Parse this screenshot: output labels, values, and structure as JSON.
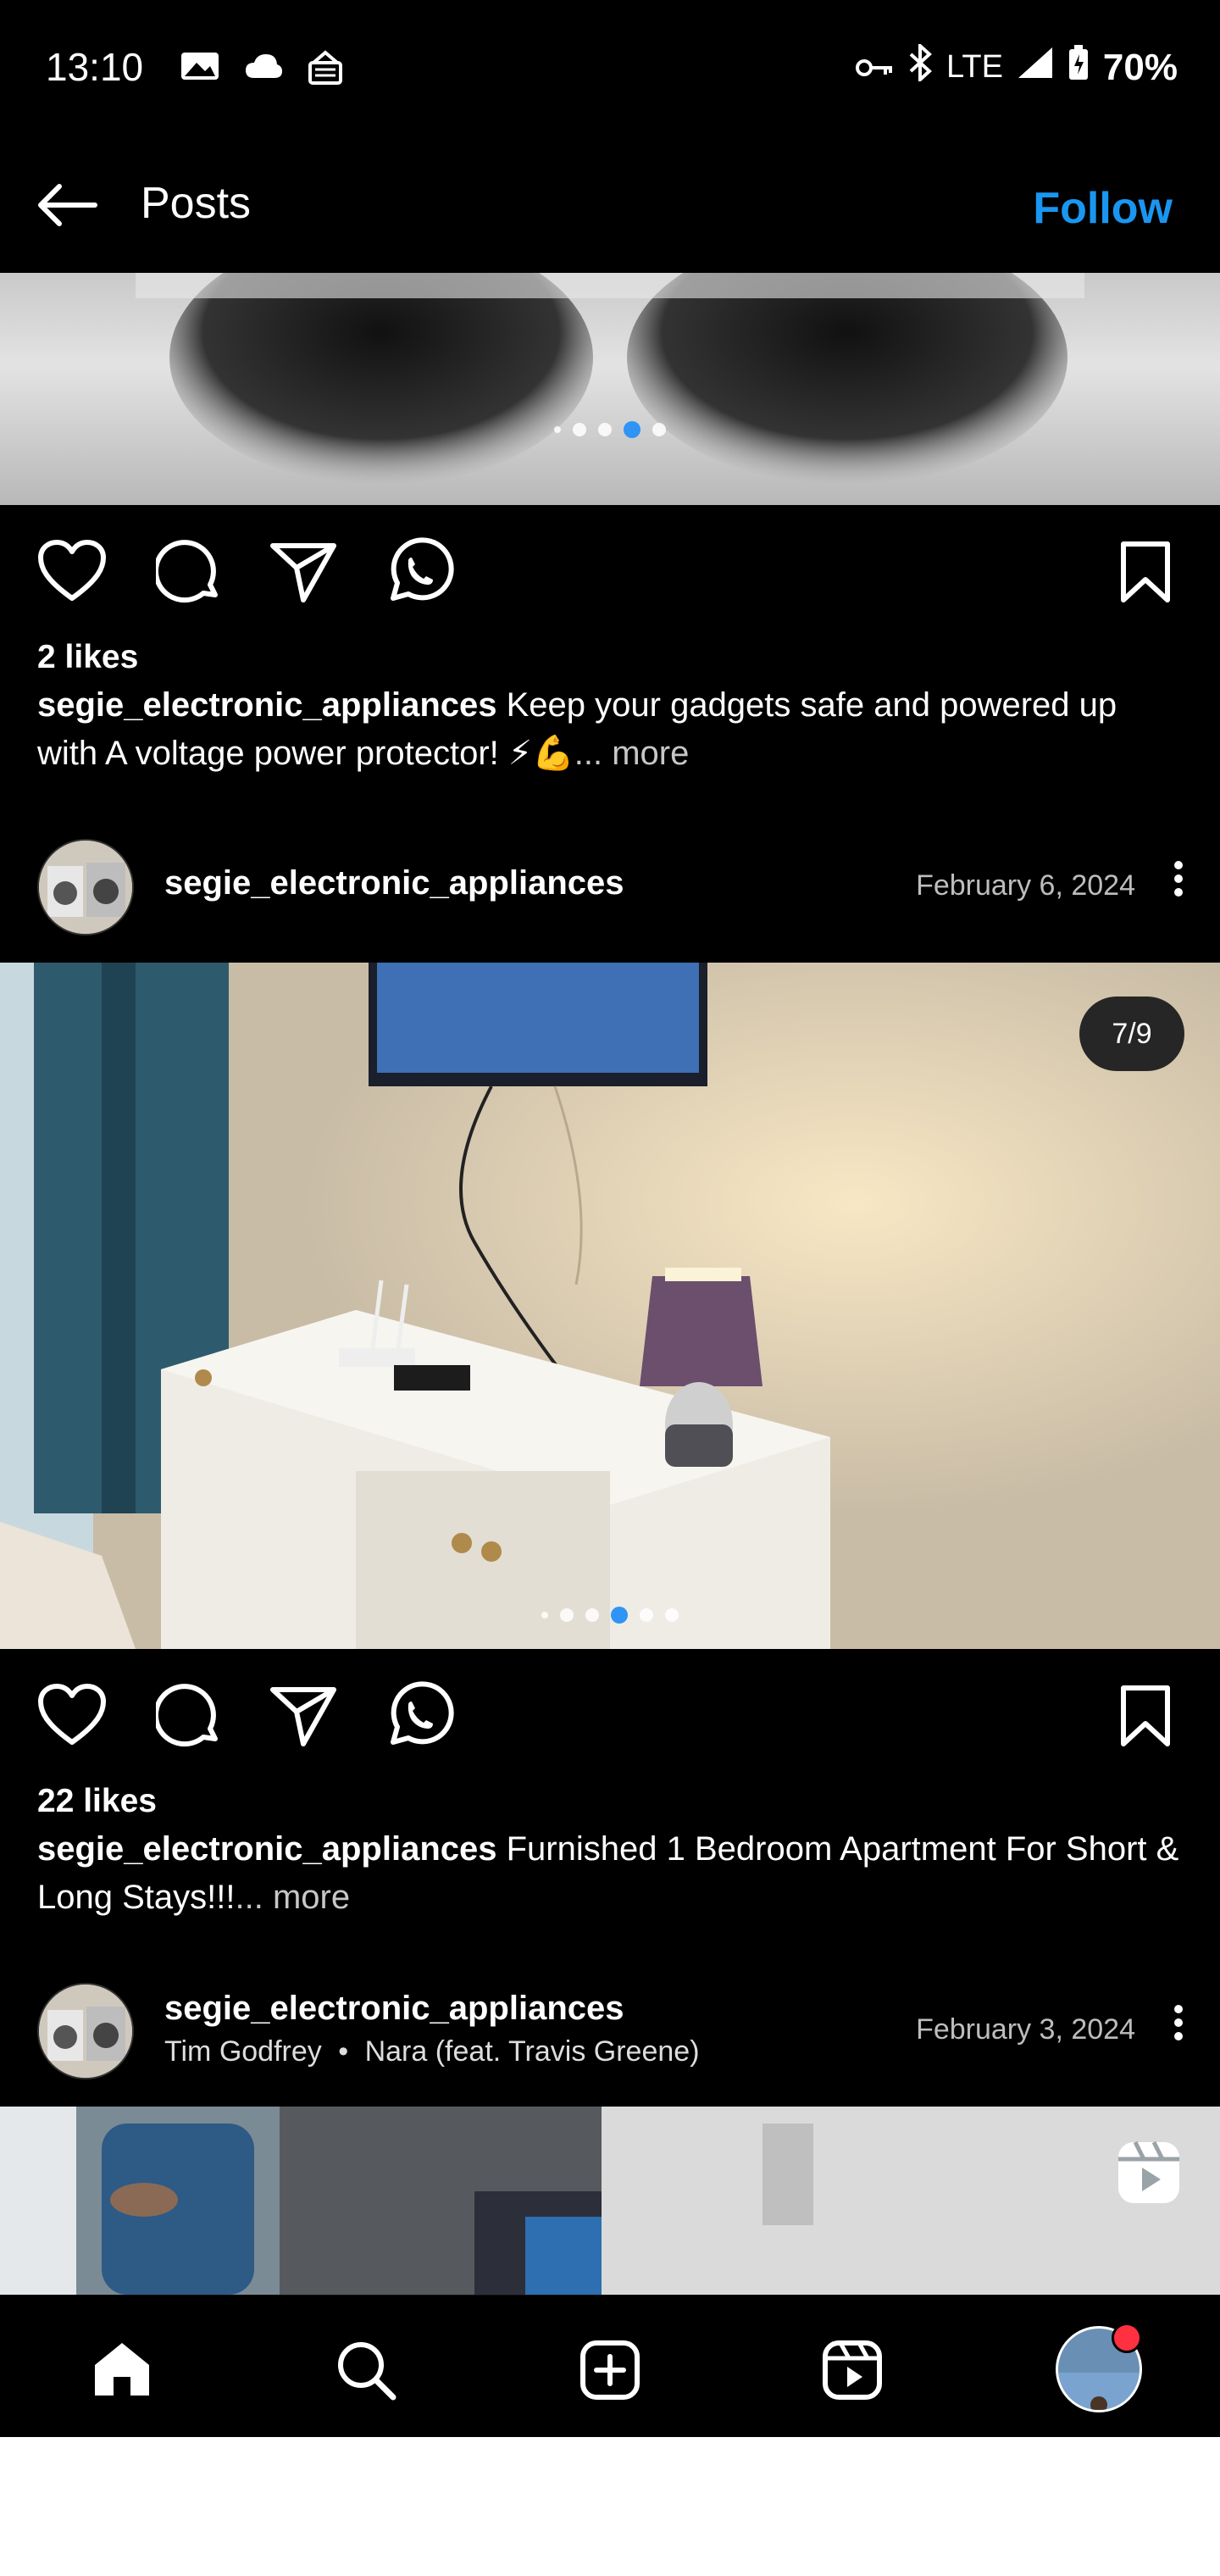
{
  "status_bar": {
    "time": "13:10",
    "network": "LTE",
    "battery": "70%",
    "icons": [
      "photo-icon",
      "cloud-icon",
      "sim-icon",
      "key-icon",
      "bluetooth-icon",
      "signal-icon",
      "battery-icon"
    ]
  },
  "header": {
    "back_icon": "arrow-left-icon",
    "title": "Posts",
    "follow_label": "Follow",
    "follow_color": "#1a96f0"
  },
  "post1": {
    "likes": "2 likes",
    "username": "segie_electronic_appliances",
    "caption_text": " Keep your gadgets safe and powered up with A voltage power protector! ⚡💪",
    "more_label": "... more",
    "carousel_active_index": 3
  },
  "post2": {
    "username": "segie_electronic_appliances",
    "date": "February 6, 2024",
    "counter": "7/9",
    "likes": "22 likes",
    "caption_username": "segie_electronic_appliances",
    "caption_text": " Furnished 1 Bedroom Apartment For Short & Long Stays!!!",
    "more_label": "... more"
  },
  "post3": {
    "username": "segie_electronic_appliances",
    "music_artist": "Tim Godfrey",
    "music_song": "Nara (feat. Travis Greene)",
    "date": "February 3, 2024",
    "reel_icon": "reels-icon"
  },
  "bottom_nav": {
    "items": [
      "home-icon",
      "search-icon",
      "create-icon",
      "reels-icon",
      "profile-avatar"
    ],
    "notification_color": "#ff3040"
  }
}
